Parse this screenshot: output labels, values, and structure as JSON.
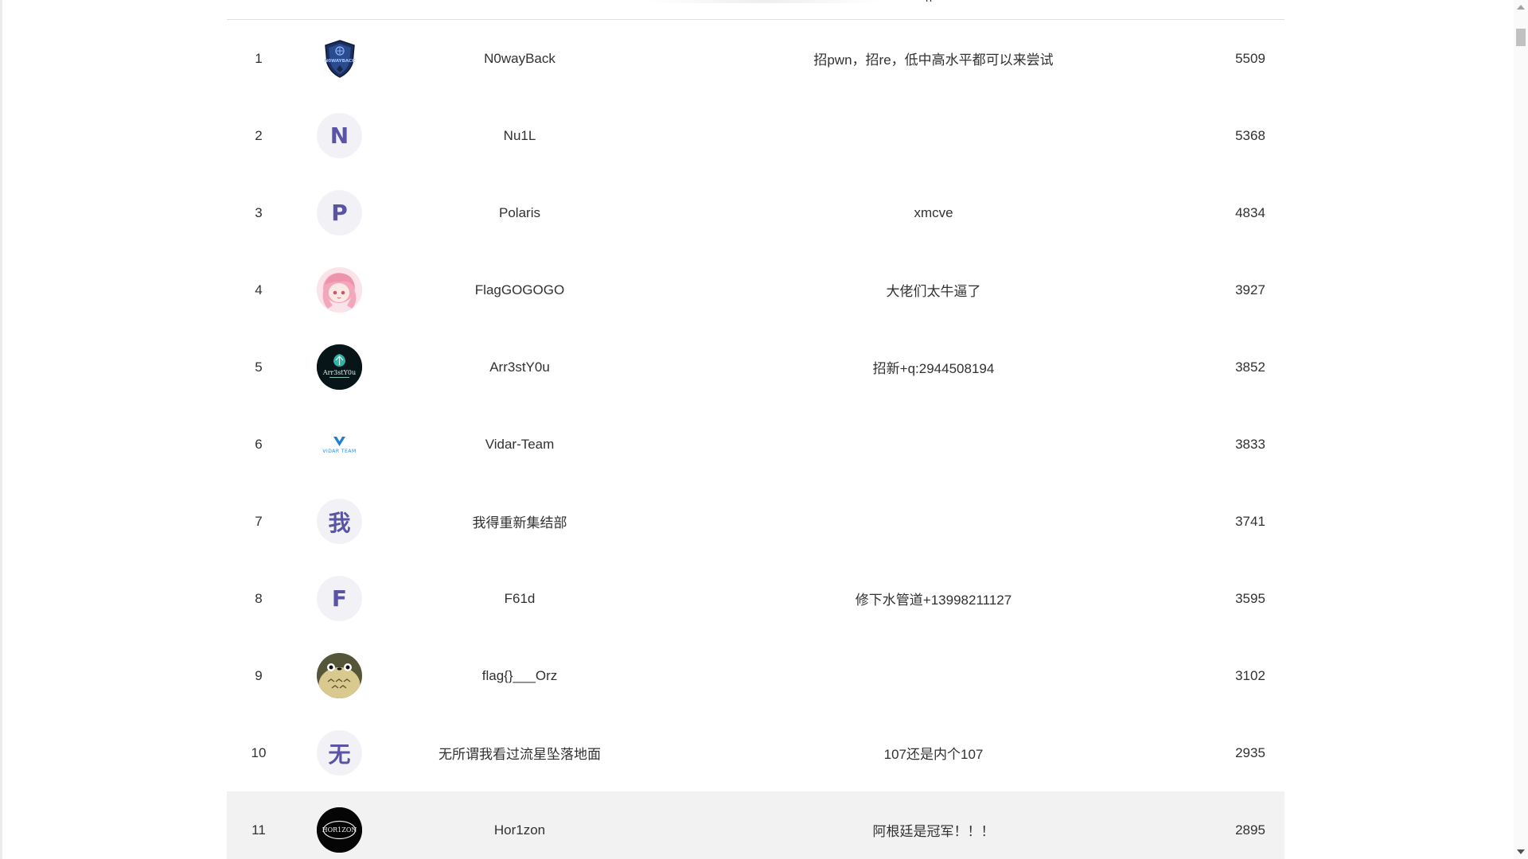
{
  "scoreboard": {
    "rows": [
      {
        "rank": "1",
        "name": "N0wayBack",
        "motto": "招pwn，招re，低中高水平都可以来尝试",
        "score": "5509",
        "avatar": {
          "kind": "image",
          "icon": "shield-logo-icon",
          "letter": ""
        }
      },
      {
        "rank": "2",
        "name": "Nu1L",
        "motto": "",
        "score": "5368",
        "avatar": {
          "kind": "letter",
          "icon": "letter-avatar",
          "letter": "N"
        }
      },
      {
        "rank": "3",
        "name": "Polaris",
        "motto": "xmcve",
        "score": "4834",
        "avatar": {
          "kind": "letter",
          "icon": "letter-avatar",
          "letter": "P"
        }
      },
      {
        "rank": "4",
        "name": "FlagGOGOGO",
        "motto": "大佬们太牛逼了",
        "score": "3927",
        "avatar": {
          "kind": "image",
          "icon": "anime-girl-icon",
          "letter": ""
        }
      },
      {
        "rank": "5",
        "name": "Arr3stY0u",
        "motto": "招新+q:2944508194",
        "score": "3852",
        "avatar": {
          "kind": "image",
          "icon": "team-logo-icon",
          "letter": ""
        }
      },
      {
        "rank": "6",
        "name": "Vidar-Team",
        "motto": "",
        "score": "3833",
        "avatar": {
          "kind": "image",
          "icon": "vidar-logo-icon",
          "letter": ""
        }
      },
      {
        "rank": "7",
        "name": "我得重新集结部",
        "motto": "",
        "score": "3741",
        "avatar": {
          "kind": "letter",
          "icon": "letter-avatar",
          "letter": "我"
        }
      },
      {
        "rank": "8",
        "name": "F61d",
        "motto": "修下水管道+13998211127",
        "score": "3595",
        "avatar": {
          "kind": "letter",
          "icon": "letter-avatar",
          "letter": "F"
        }
      },
      {
        "rank": "9",
        "name": "flag{}___Orz",
        "motto": "",
        "score": "3102",
        "avatar": {
          "kind": "image",
          "icon": "totoro-icon",
          "letter": ""
        }
      },
      {
        "rank": "10",
        "name": "无所谓我看过流星坠落地面",
        "motto": "107还是内个107",
        "score": "2935",
        "avatar": {
          "kind": "letter",
          "icon": "letter-avatar",
          "letter": "无"
        }
      },
      {
        "rank": "11",
        "name": "Hor1zon",
        "motto": "阿根廷是冠军！！！",
        "score": "2895",
        "avatar": {
          "kind": "image",
          "icon": "horizon-logo-icon",
          "letter": ""
        }
      }
    ]
  },
  "logos": {
    "n0waybackText": "N0WAYBACK",
    "arr3stText": "Arr3stY0u",
    "vidarText": "VIDAR TEAM",
    "horizonText": "HOR1ZON"
  },
  "colors": {
    "avatarLetter": "#5b54a6",
    "avatarBg": "#f2f2f6",
    "highlightRow": "#f2f2f2",
    "divider": "#dcdfe6"
  }
}
